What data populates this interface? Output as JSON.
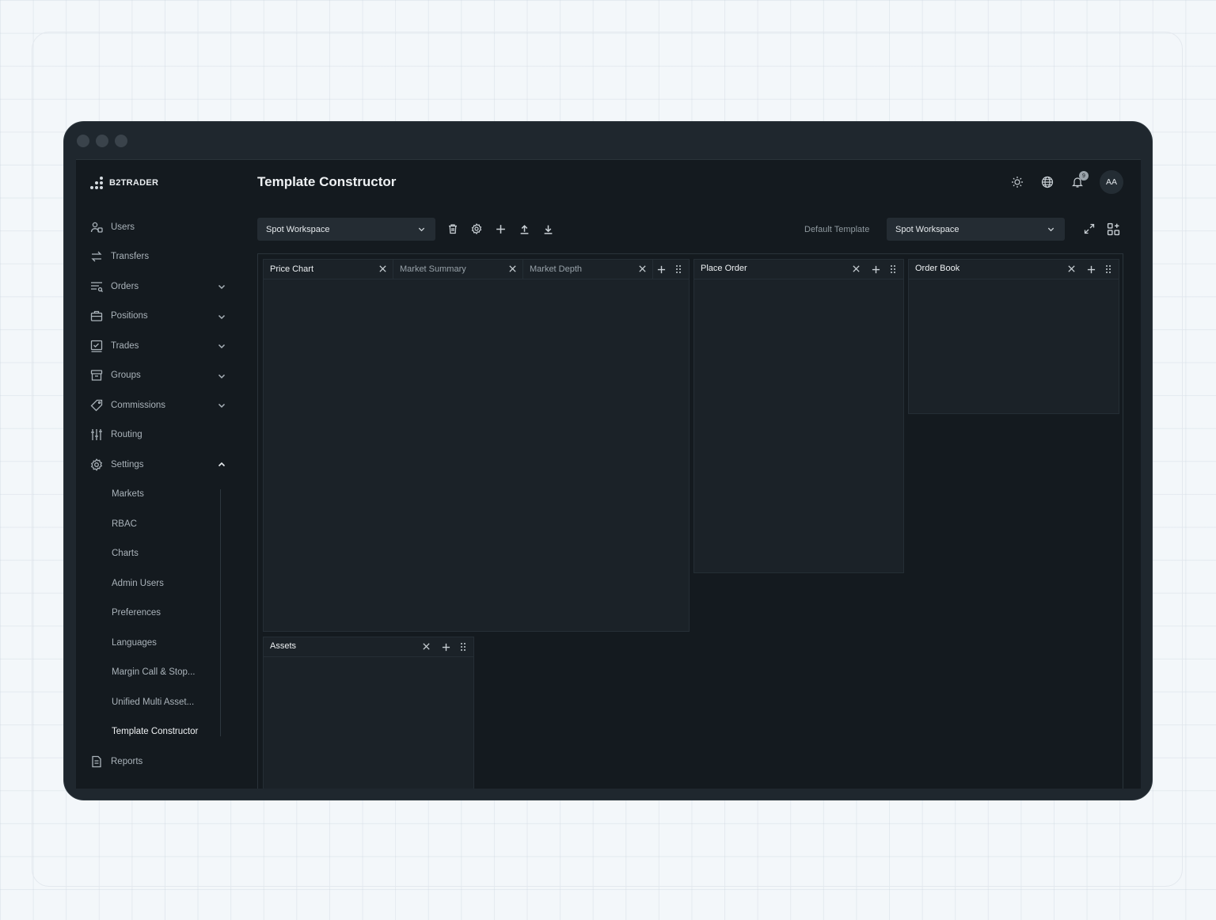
{
  "app": {
    "logo_text": "B2TRADER",
    "page_title": "Template Constructor"
  },
  "header": {
    "notification_count": "9",
    "avatar_initials": "AA"
  },
  "sidebar": {
    "items": [
      {
        "label": "Users",
        "icon": "users-icon",
        "expandable": false
      },
      {
        "label": "Transfers",
        "icon": "transfers-icon",
        "expandable": false
      },
      {
        "label": "Orders",
        "icon": "orders-icon",
        "expandable": true
      },
      {
        "label": "Positions",
        "icon": "positions-icon",
        "expandable": true
      },
      {
        "label": "Trades",
        "icon": "trades-icon",
        "expandable": true
      },
      {
        "label": "Groups",
        "icon": "groups-icon",
        "expandable": true
      },
      {
        "label": "Commissions",
        "icon": "commissions-icon",
        "expandable": true
      },
      {
        "label": "Routing",
        "icon": "routing-icon",
        "expandable": false
      },
      {
        "label": "Settings",
        "icon": "settings-icon",
        "expandable": true,
        "expanded": true
      }
    ],
    "settings_sub": [
      "Markets",
      "RBAC",
      "Charts",
      "Admin Users",
      "Preferences",
      "Languages",
      "Margin Call & Stop...",
      "Unified Multi Asset...",
      "Template Constructor"
    ],
    "active_sub": "Template Constructor",
    "after_items": [
      {
        "label": "Reports",
        "icon": "reports-icon"
      }
    ]
  },
  "toolbar": {
    "workspace_select": "Spot Workspace",
    "default_template_label": "Default Template",
    "default_template_select": "Spot Workspace"
  },
  "panels": {
    "main_tabs": [
      "Price Chart",
      "Market Summary",
      "Market Depth"
    ],
    "place_order": "Place Order",
    "order_book": "Order Book",
    "assets": "Assets"
  },
  "colors": {
    "background": "#141a1f",
    "panel": "#1b2228",
    "text": "#eef1f3",
    "muted": "#98a2a9"
  }
}
